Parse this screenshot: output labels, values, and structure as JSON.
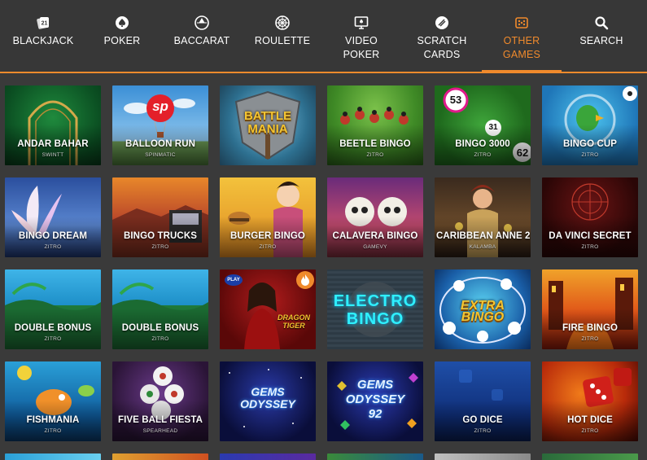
{
  "nav": {
    "items": [
      {
        "label": "BLACKJACK",
        "icon": "blackjack-21-icon",
        "active": false
      },
      {
        "label": "POKER",
        "icon": "spade-icon",
        "active": false
      },
      {
        "label": "BACCARAT",
        "icon": "baccarat-icon",
        "active": false
      },
      {
        "label": "ROULETTE",
        "icon": "roulette-wheel-icon",
        "active": false
      },
      {
        "label": "VIDEO POKER",
        "icon": "video-poker-monitor-icon",
        "active": false
      },
      {
        "label": "SCRATCH\nCARDS",
        "icon": "scratch-card-icon",
        "active": false
      },
      {
        "label": "OTHER\nGAMES",
        "icon": "other-games-icon",
        "active": true
      },
      {
        "label": "SEARCH",
        "icon": "search-icon",
        "active": false
      }
    ],
    "accent_color": "#f08a2c"
  },
  "games": [
    {
      "title": "ANDAR BAHAR",
      "provider": "SWINTT"
    },
    {
      "title": "BALLOON RUN",
      "provider": "SPINMATIC",
      "logo_text": "sp"
    },
    {
      "title": "",
      "provider": "",
      "logo_text": "BATTLE MANIA"
    },
    {
      "title": "BEETLE BINGO",
      "provider": "ZITRO"
    },
    {
      "title": "BINGO 3000",
      "provider": "ZITRO",
      "ball_numbers": [
        "53",
        "31",
        "62"
      ]
    },
    {
      "title": "BINGO CUP",
      "provider": "ZITRO"
    },
    {
      "title": "BINGO DREAM",
      "provider": "ZITRO"
    },
    {
      "title": "BINGO TRUCKS",
      "provider": "ZITRO"
    },
    {
      "title": "BURGER BINGO",
      "provider": "ZITRO"
    },
    {
      "title": "CALAVERA BINGO",
      "provider": "GAMEVY"
    },
    {
      "title": "CARIBBEAN ANNE 2",
      "provider": "KALAMBA"
    },
    {
      "title": "DA VINCI SECRET",
      "provider": "ZITRO"
    },
    {
      "title": "DOUBLE BONUS",
      "provider": "ZITRO"
    },
    {
      "title": "DOUBLE BONUS",
      "provider": "ZITRO"
    },
    {
      "title": "",
      "provider": "",
      "logo_text": "DRAGON TIGER",
      "badge_text": "PLAY"
    },
    {
      "title": "",
      "provider": "",
      "logo_text": "ELECTRO BINGO"
    },
    {
      "title": "",
      "provider": "",
      "logo_text": "EXTRA BINGO"
    },
    {
      "title": "FIRE BINGO",
      "provider": "ZITRO"
    },
    {
      "title": "FISHMANIA",
      "provider": "ZITRO"
    },
    {
      "title": "FIVE BALL FIESTA",
      "provider": "SPEARHEAD"
    },
    {
      "title": "",
      "provider": "",
      "logo_text": "GEMS ODYSSEY"
    },
    {
      "title": "",
      "provider": "",
      "logo_text": "GEMS ODYSSEY 92"
    },
    {
      "title": "GO DICE",
      "provider": "ZITRO"
    },
    {
      "title": "HOT DICE",
      "provider": "ZITRO"
    }
  ]
}
